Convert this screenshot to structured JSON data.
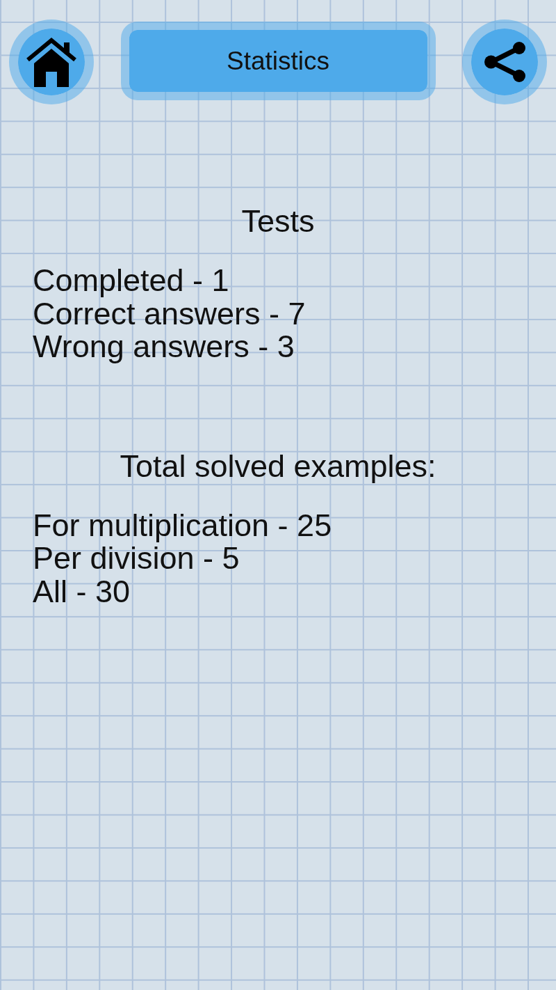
{
  "header": {
    "title": "Statistics"
  },
  "sections": [
    {
      "heading": "Tests",
      "lines": [
        "Completed - 1",
        "Correct answers - 7",
        "Wrong answers - 3"
      ]
    },
    {
      "heading": "Total solved examples:",
      "lines": [
        "For multiplication - 25",
        "Per division - 5",
        "All - 30"
      ]
    }
  ]
}
